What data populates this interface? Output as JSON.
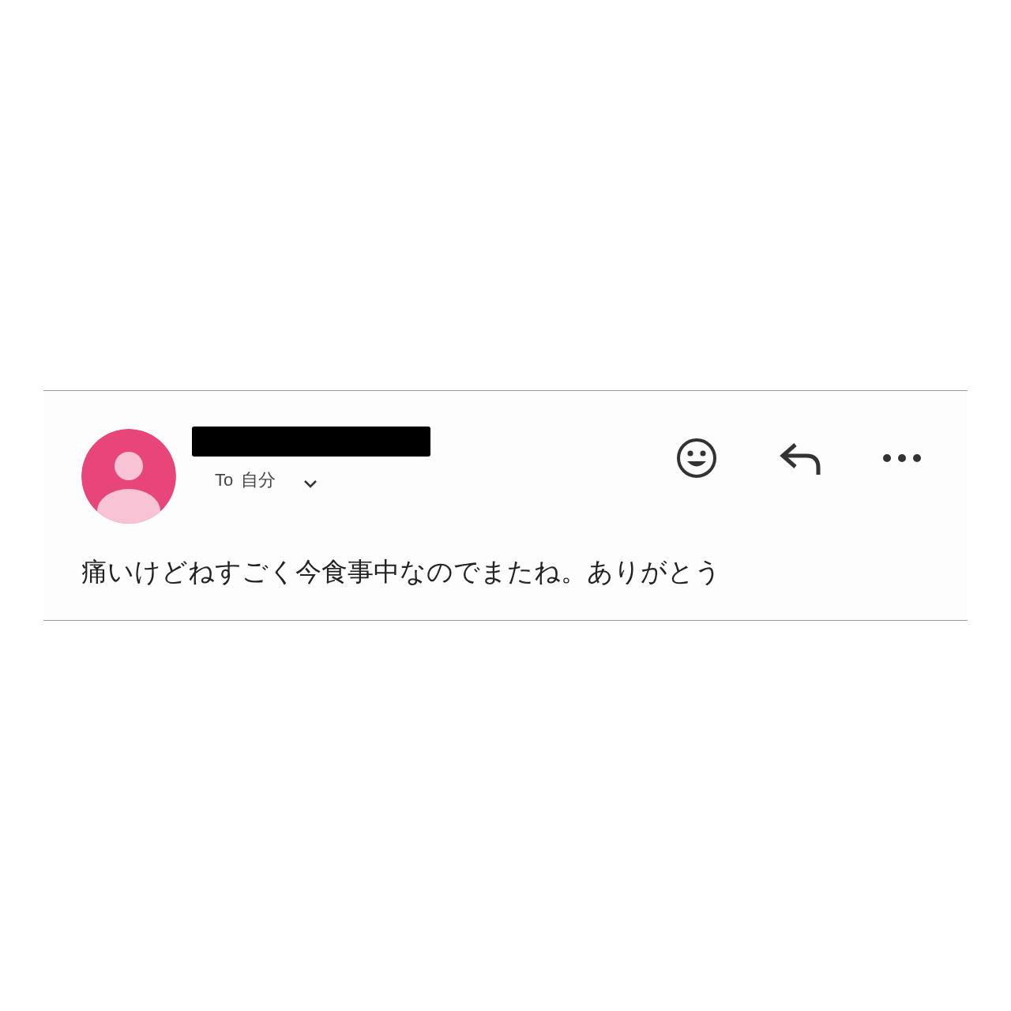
{
  "message": {
    "sender": {
      "redacted": true
    },
    "recipient_prefix": "To",
    "recipient": "自分",
    "details_expanded": false,
    "body": "痛いけどねすごく今食事中なのでまたね。ありがとう"
  }
}
